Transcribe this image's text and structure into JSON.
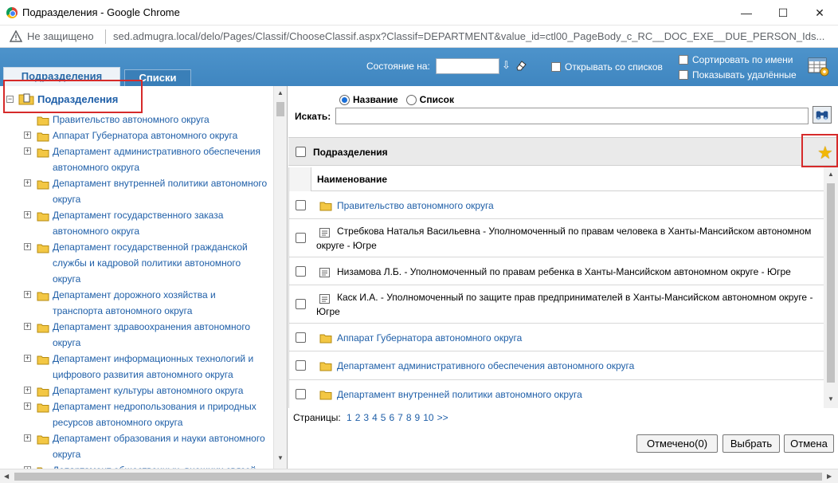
{
  "window": {
    "title": "Подразделения - Google Chrome",
    "minimize": "—",
    "maximize": "☐",
    "close": "✕"
  },
  "address": {
    "not_secure": "Не защищено",
    "url": "sed.admugra.local/delo/Pages/Classif/ChooseClassif.aspx?Classif=DEPARTMENT&value_id=ctl00_PageBody_c_RC__DOC_EXE__DUE_PERSON_Ids..."
  },
  "toolbar": {
    "tabs": [
      {
        "label": "Подразделения",
        "active": true
      },
      {
        "label": "Списки",
        "active": false
      }
    ],
    "state_label": "Состояние на:",
    "state_value": "",
    "open_with_lists": "Открывать со списков",
    "sort_by_name": "Сортировать по имени",
    "show_deleted": "Показывать удалённые"
  },
  "tree": {
    "root_label": "Подразделения",
    "items": [
      {
        "label": "Правительство автономного округа",
        "expandable": false
      },
      {
        "label": "Аппарат Губернатора автономного округа",
        "expandable": true
      },
      {
        "label": "Департамент административного обеспечения автономного округа",
        "expandable": true
      },
      {
        "label": "Департамент внутренней политики автономного округа",
        "expandable": true
      },
      {
        "label": "Департамент государственного заказа автономного округа",
        "expandable": true
      },
      {
        "label": "Департамент государственной гражданской службы и кадровой политики автономного округа",
        "expandable": true
      },
      {
        "label": "Департамент дорожного хозяйства и транспорта автономного округа",
        "expandable": true
      },
      {
        "label": "Департамент здравоохранения автономного округа",
        "expandable": true
      },
      {
        "label": "Департамент информационных технологий и цифрового развития автономного округа",
        "expandable": true
      },
      {
        "label": "Департамент культуры автономного округа",
        "expandable": true
      },
      {
        "label": "Департамент недропользования и природных ресурсов автономного округа",
        "expandable": true
      },
      {
        "label": "Департамент образования и науки автономного округа",
        "expandable": true
      },
      {
        "label": "Департамент общественных, внешних связей",
        "expandable": true
      }
    ]
  },
  "search": {
    "mode_name": "Название",
    "mode_list": "Список",
    "mode_selected": "name",
    "label": "Искать:",
    "value": ""
  },
  "grid": {
    "header_title": "Подразделения",
    "column_name": "Наименование",
    "rows": [
      {
        "type": "folder",
        "text": "Правительство автономного округа"
      },
      {
        "type": "person",
        "text": "Стребкова Наталья Васильевна - Уполномоченный по правам человека в Ханты-Мансийском автономном округе - Югре"
      },
      {
        "type": "person",
        "text": "Низамова Л.Б. - Уполномоченный по правам ребенка в Ханты-Мансийском автономном округе - Югре"
      },
      {
        "type": "person",
        "text": "Каск И.А. - Уполномоченный по защите прав предпринимателей в Ханты-Мансийском автономном округе - Югре"
      },
      {
        "type": "folder",
        "text": "Аппарат Губернатора автономного округа"
      },
      {
        "type": "folder",
        "text": "Департамент административного обеспечения автономного округа"
      },
      {
        "type": "folder",
        "text": "Департамент внутренней политики автономного округа"
      }
    ]
  },
  "pagination": {
    "label": "Страницы:",
    "pages": [
      "1",
      "2",
      "3",
      "4",
      "5",
      "6",
      "7",
      "8",
      "9",
      "10",
      ">>"
    ]
  },
  "buttons": {
    "marked": "Отмечено(0)",
    "select": "Выбрать",
    "cancel": "Отмена"
  }
}
